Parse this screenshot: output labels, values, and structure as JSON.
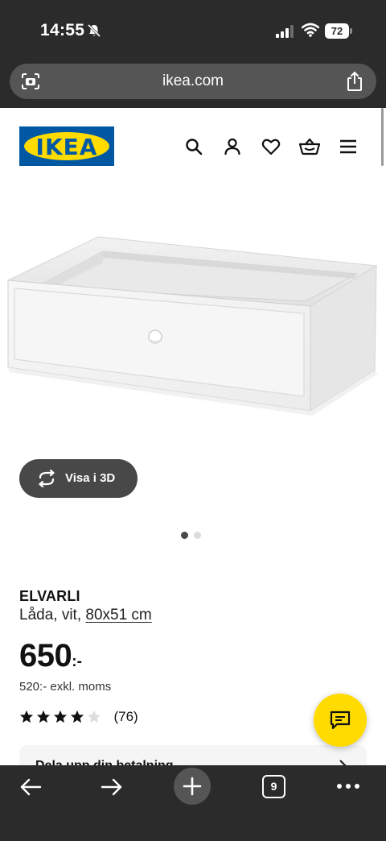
{
  "status_bar": {
    "time": "14:55",
    "battery": "72"
  },
  "browser": {
    "url": "ikea.com",
    "tab_count": "9"
  },
  "header": {
    "logo_text": "IKEA",
    "brand_colors": {
      "blue": "#0058a3",
      "yellow": "#ffdb00"
    },
    "icons": [
      "search-icon",
      "account-icon",
      "heart-icon",
      "cart-icon",
      "menu-icon"
    ]
  },
  "gallery": {
    "view_3d_label": "Visa i 3D",
    "dot_count": 2,
    "active_dot": 0
  },
  "product": {
    "name": "ELVARLI",
    "description": "Låda, vit, ",
    "size_link": "80x51 cm",
    "price": "650",
    "price_suffix": ":-",
    "price_excl": "520:- exkl. moms",
    "rating": 4,
    "rating_max": 5,
    "review_count": "(76)"
  },
  "info_card": {
    "label": "Dela upp din betalning"
  }
}
